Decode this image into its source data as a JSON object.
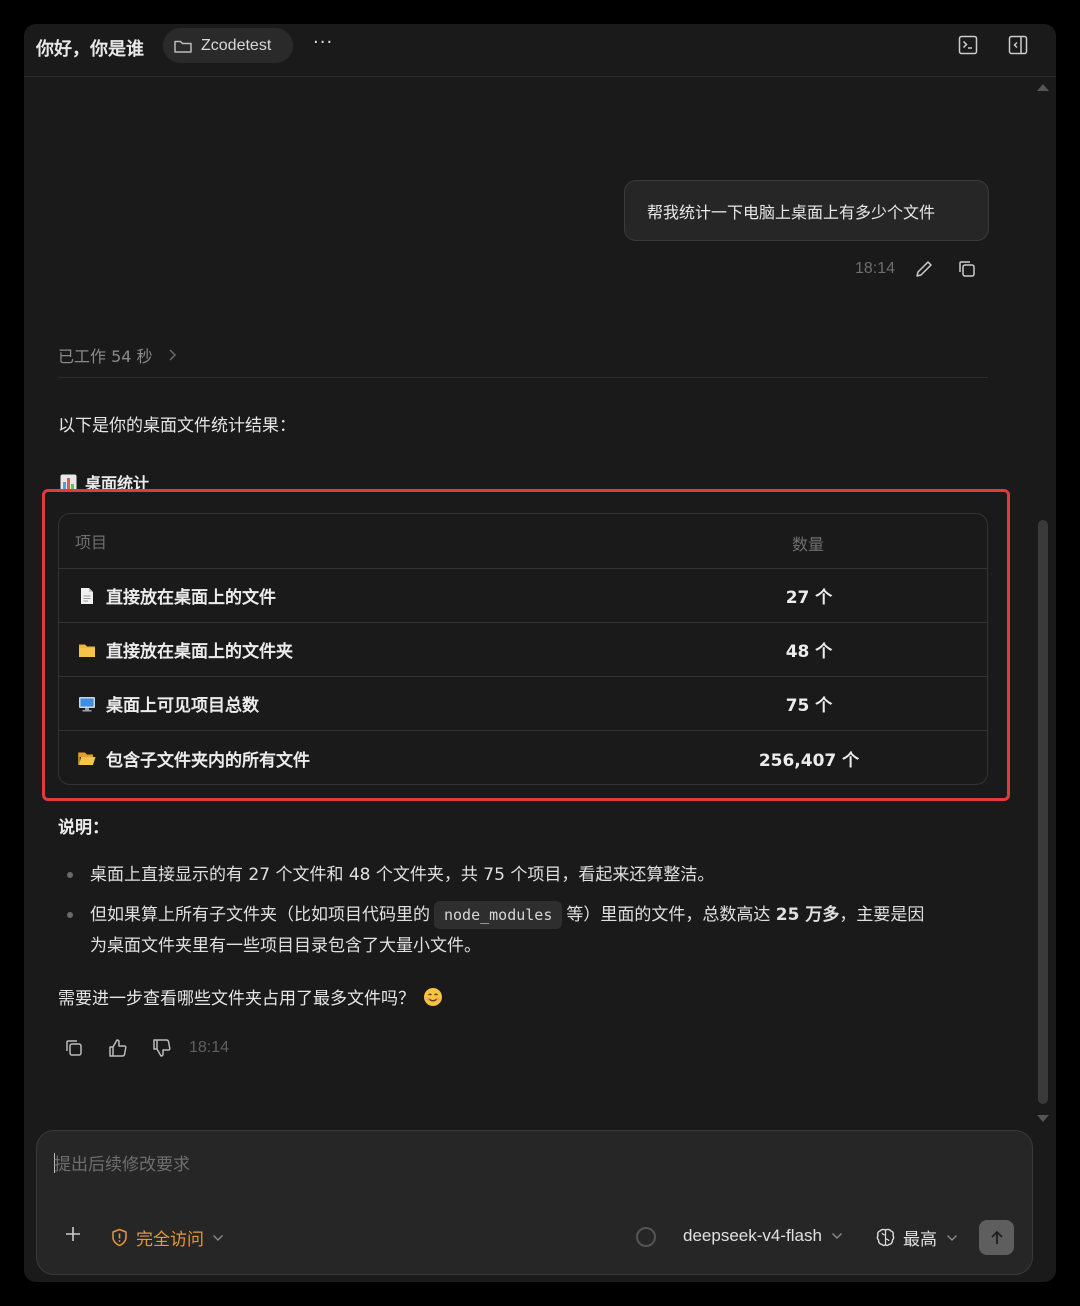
{
  "header": {
    "title": "你好，你是谁",
    "folder": "Zcodetest",
    "more": "···"
  },
  "user_message": {
    "text": "帮我统计一下电脑上桌面上有多少个文件",
    "time": "18:14"
  },
  "assistant": {
    "worked": "已工作 54 秒",
    "intro": "以下是你的桌面文件统计结果：",
    "stats_title": "桌面统计",
    "table": {
      "headers": [
        "项目",
        "数量"
      ],
      "rows": [
        {
          "icon": "document-icon",
          "name": "直接放在桌面上的文件",
          "value": "27 个"
        },
        {
          "icon": "folder-icon",
          "name": "直接放在桌面上的文件夹",
          "value": "48 个"
        },
        {
          "icon": "desktop-icon",
          "name": "桌面上可见项目总数",
          "value": "75 个"
        },
        {
          "icon": "open-folder-icon",
          "name": "包含子文件夹内的所有文件",
          "value": "256,407 个"
        }
      ]
    },
    "note_title": "说明：",
    "bullets": {
      "b1": "桌面上直接显示的有 27 个文件和 48 个文件夹，共 75 个项目，看起来还算整洁。",
      "b2_pre": "但如果算上所有子文件夹（比如项目代码里的",
      "b2_code": "node_modules",
      "b2_mid": "等）里面的文件，总数高达",
      "b2_bold": "25 万多",
      "b2_post": "，主要是因",
      "b2_line2": "为桌面文件夹里有一些项目目录包含了大量小文件。"
    },
    "question": "需要进一步查看哪些文件夹占用了最多文件吗？",
    "time": "18:14"
  },
  "composer": {
    "placeholder": "提出后续修改要求",
    "access": "完全访问",
    "model": "deepseek-v4-flash",
    "level": "最高"
  },
  "colors": {
    "accent_orange": "#e8963c",
    "highlight_red": "#e03c3c",
    "background": "#1a1a1a"
  }
}
